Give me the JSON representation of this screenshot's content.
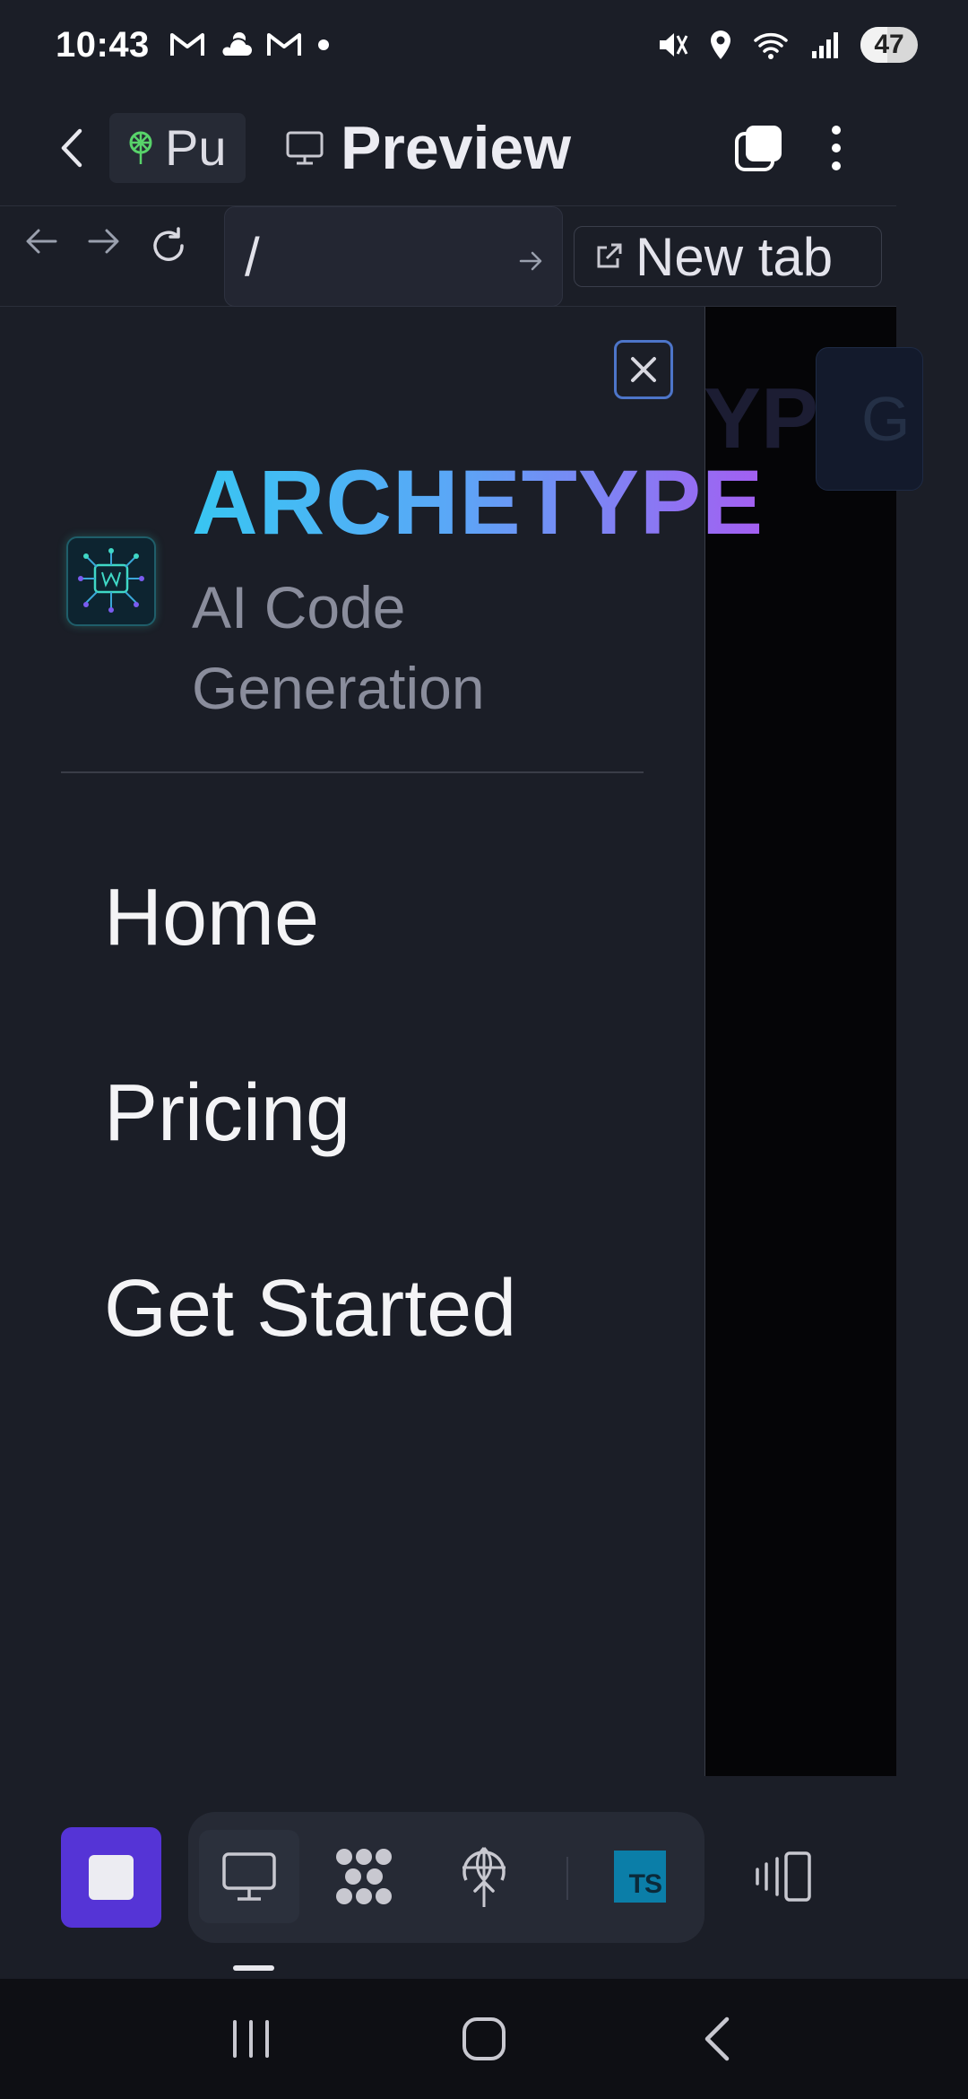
{
  "status_bar": {
    "time": "10:43",
    "battery": "47",
    "left_icons": [
      "gmail-icon",
      "weather-icon",
      "gmail-icon",
      "dot-icon"
    ],
    "right_icons": [
      "mute-icon",
      "location-icon",
      "wifi-icon",
      "signal-icon"
    ]
  },
  "header": {
    "project_label": "Pu",
    "title": "Preview"
  },
  "url_bar": {
    "path": "/",
    "new_tab_label": "New tab"
  },
  "background_page": {
    "brand_fragment": "YP",
    "button_fragment": "G"
  },
  "drawer": {
    "brand_name": "ARCHETYPE",
    "tagline": "AI Code Generation",
    "nav": {
      "home": "Home",
      "pricing": "Pricing",
      "get_started": "Get Started"
    }
  },
  "toolbar": {
    "ts_label": "TS"
  },
  "colors": {
    "background": "#1b1e27",
    "accent_purple": "#5534d6",
    "brand_gradient_start": "#38c6f2",
    "brand_gradient_end": "#a45ef1",
    "close_border": "#4d75c9"
  }
}
